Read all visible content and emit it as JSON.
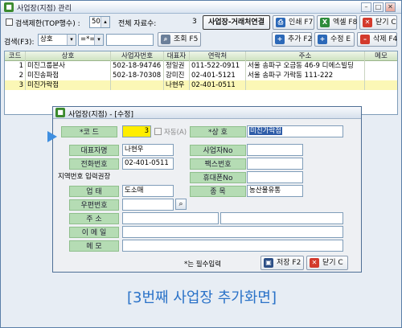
{
  "window": {
    "title": "사업장(지점) 관리"
  },
  "toolbar": {
    "limit_label": "검색제한(TOP행수) :",
    "limit_value": "50",
    "total_label": "전체 자료수:",
    "total_value": "3",
    "link_button": "사업장-거래처연결",
    "print_button": "인쇄 F7",
    "excel_button": "엑셀 F8",
    "close_button": "닫기 C"
  },
  "search": {
    "label": "검색(F3):",
    "field_value": "상호",
    "op_value": "=*=",
    "query_value": "",
    "search_button": "조회 F5",
    "add_button": "추가 F2",
    "edit_button": "수정 E",
    "delete_button": "삭제 F4"
  },
  "grid": {
    "columns": [
      "코드",
      "상호",
      "사업자번호",
      "대표자",
      "연락처",
      "주소",
      "메모"
    ],
    "rows": [
      [
        "1",
        "미진그룹본사",
        "502-18-94746",
        "정일권",
        "011-522-0911",
        "서울 송파구 오금동 46-9 디에스빌딩",
        ""
      ],
      [
        "2",
        "미진송파점",
        "502-18-70308",
        "강미진",
        "02-401-5121",
        "서울 송파구 가락동 111-222",
        ""
      ],
      [
        "3",
        "미진가락점",
        "",
        "나현우",
        "02-401-0511",
        "",
        ""
      ]
    ]
  },
  "dialog": {
    "title": "사업장(지점) - [수정]",
    "code_label": "*코  드",
    "code_value": "3",
    "auto_label": "자동(A)",
    "name_label": "*상  호",
    "name_value": "미진가락점",
    "rep_label": "대표자명",
    "rep_value": "나현우",
    "bizno_label": "사업자No",
    "bizno_value": "",
    "phone_label": "전화번호",
    "phone_value": "02-401-0511",
    "fax_label": "팩스번호",
    "fax_value": "",
    "area_label": "지역번호 입력권장",
    "mobile_label": "휴대폰No",
    "mobile_value": "",
    "biztype_label": "업  태",
    "biztype_value": "도소매",
    "item_label": "종  목",
    "item_value": "농산물유통",
    "zip_label": "우편번호",
    "zip_value": "",
    "addr_label": "주  소",
    "addr_value": "",
    "email_label": "이 메 일",
    "email_value": "",
    "memo_label": "메  모",
    "memo_value": "",
    "required_note": "*는 필수입력",
    "save_button": "저장 F2",
    "close_button": "닫기 C"
  },
  "caption": "[3번째 사업장 추가화면]",
  "colors": {
    "accent_green": "#b5dcb4",
    "selected_row": "#fbf7b6",
    "code_highlight": "#ffee00",
    "caption": "#2a72c8"
  }
}
